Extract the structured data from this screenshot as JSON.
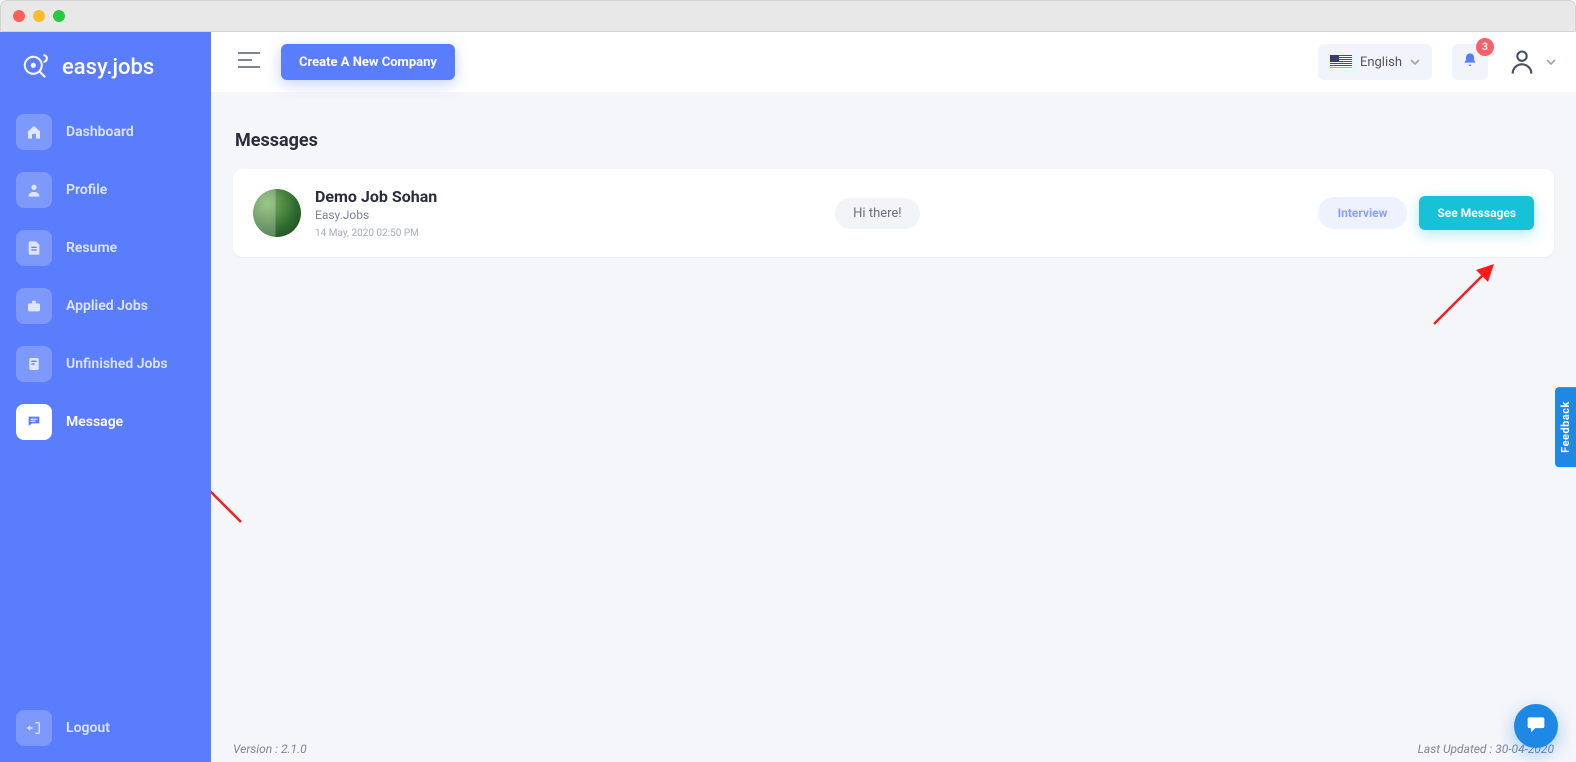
{
  "brand": {
    "name": "easy.jobs"
  },
  "sidebar": {
    "items": [
      {
        "label": "Dashboard"
      },
      {
        "label": "Profile"
      },
      {
        "label": "Resume"
      },
      {
        "label": "Applied Jobs"
      },
      {
        "label": "Unfinished Jobs"
      },
      {
        "label": "Message"
      }
    ],
    "logout_label": "Logout"
  },
  "topbar": {
    "create_company_label": "Create A New Company",
    "language_label": "English",
    "notification_count": "3"
  },
  "page": {
    "title": "Messages"
  },
  "message_card": {
    "name": "Demo Job Sohan",
    "company": "Easy.Jobs",
    "timestamp": "14 May, 2020 02:50 PM",
    "preview": "Hi there!",
    "interview_label": "Interview",
    "see_messages_label": "See Messages"
  },
  "footer": {
    "version_label": "Version : 2.1.0",
    "last_updated_label": "Last Updated : 30-04-2020"
  },
  "feedback": {
    "label": "Feedback"
  }
}
